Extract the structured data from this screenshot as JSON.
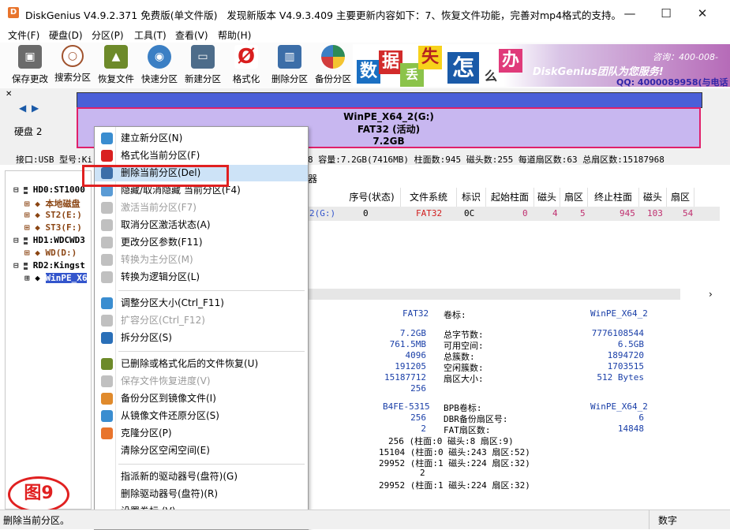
{
  "window": {
    "title": "DiskGenius V4.9.2.371 免费版(单文件版)",
    "notice": "发现新版本 V4.9.3.409 主要更新内容如下：7、恢复文件功能，完善对mp4格式的支持。",
    "minimize": "—",
    "maximize": "☐",
    "close": "✕",
    "icon_letter": "D"
  },
  "menu": [
    "文件(F)",
    "硬盘(D)",
    "分区(P)",
    "工具(T)",
    "查看(V)",
    "帮助(H)"
  ],
  "toolbar": [
    {
      "label": "保存更改",
      "icon": "save-icon",
      "color": "#6b6b6b"
    },
    {
      "label": "搜索分区",
      "icon": "magnifier-icon",
      "color": "#a0522d"
    },
    {
      "label": "恢复文件",
      "icon": "recover-box-icon",
      "color": "#6d8a2a"
    },
    {
      "label": "快速分区",
      "icon": "disk-icon",
      "color": "#3b7fc4"
    },
    {
      "label": "新建分区",
      "icon": "laptop-icon",
      "color": "#4d6c8a"
    },
    {
      "label": "格式化",
      "icon": "no-sign-icon",
      "color": "#d91e1e"
    },
    {
      "label": "删除分区",
      "icon": "trash-icon",
      "color": "#3c6ea8"
    },
    {
      "label": "备份分区",
      "icon": "pie-icon",
      "color": "#2e8b57"
    }
  ],
  "banner": {
    "tiles": [
      "数",
      "据",
      "丢",
      "失",
      "怎",
      "么",
      "办"
    ],
    "brand": "DiskGenius团队为您服务!",
    "phone": "咨询：400-008-",
    "qq": "QQ: 4000089958(与电话"
  },
  "disk_header": {
    "disk_label": "硬盘 2",
    "partition_name": "WinPE_X64_2(G:)",
    "partition_fs": "FAT32 (活动)",
    "partition_size": "7.2GB"
  },
  "infobar": {
    "prefix": "接口:USB  型号:Ki",
    "suffix": "8  容量:7.2GB(7416MB)  柱面数:945  磁头数:255  每道扇区数:63  总扇区数:15187968"
  },
  "tree": [
    {
      "text": "HD0:ST1000",
      "color": "#000"
    },
    {
      "text": "本地磁盘",
      "color": "#8b4513"
    },
    {
      "text": "ST2(E:)",
      "color": "#8b4513"
    },
    {
      "text": "ST3(F:)",
      "color": "#8b4513"
    },
    {
      "text": "HD1:WDCWD3",
      "color": "#000"
    },
    {
      "text": "WD(D:)",
      "color": "#8b4513"
    },
    {
      "text": "RD2:Kingst",
      "color": "#000"
    },
    {
      "text": "WinPE_X6",
      "color": "#fff"
    }
  ],
  "table": {
    "tab_fragment": "器",
    "headers": [
      "序号(状态)",
      "文件系统",
      "标识",
      "起始柱面",
      "磁头",
      "扇区",
      "终止柱面",
      "磁头",
      "扇区"
    ],
    "row": {
      "name_fragment": "2(G:)",
      "index": "0",
      "fs": "FAT32",
      "id": "0C",
      "start_cyl": "0",
      "start_head": "4",
      "start_sector": "5",
      "end_cyl": "945",
      "end_head": "103",
      "end_sector": "54"
    }
  },
  "details": {
    "fs_type": "FAT32",
    "volume_label_key": "卷标:",
    "volume_label_val": "WinPE_X64_2",
    "left_values": [
      "7.2GB",
      "761.5MB",
      "4096",
      "191205",
      "15187712",
      "256"
    ],
    "mid_keys": [
      "总字节数:",
      "可用空间:",
      "总簇数:",
      "空闲簇数:",
      "扇区大小:"
    ],
    "right_values": [
      "7776108544",
      "6.5GB",
      "1894720",
      "1703515",
      "512 Bytes"
    ],
    "serial": "B4FE-5315",
    "bpb_key": "BPB卷标:",
    "bpb_val": "WinPE_X64_2",
    "reserved": "256",
    "dbr_key": "DBR备份扇区号:",
    "dbr_val": "6",
    "fat_count": "2",
    "fat_sectors_key": "FAT扇区数:",
    "fat_sectors_val": "14848",
    "loc1": "256 (柱面:0 磁头:8 扇区:9)",
    "loc2": "15104 (柱面:0 磁头:243 扇区:52)",
    "loc3": "29952 (柱面:1 磁头:224 扇区:32)",
    "loc4a": "2",
    "loc4b": "29952 (柱面:1 磁头:224 扇区:32)"
  },
  "context_menu": [
    {
      "label": "建立新分区(N)",
      "icon": "new-partition-icon",
      "color": "#3a8dd0",
      "disabled": false
    },
    {
      "label": "格式化当前分区(F)",
      "icon": "format-icon",
      "color": "#d92020",
      "disabled": false
    },
    {
      "label": "删除当前分区(Del)",
      "icon": "delete-partition-icon",
      "color": "#3c6ea8",
      "disabled": false,
      "highlight": true
    },
    {
      "label": "隐藏/取消隐藏 当前分区(F4)",
      "icon": "hide-icon",
      "color": "#5a9bd5",
      "disabled": false
    },
    {
      "label": "激活当前分区(F7)",
      "icon": "activate-icon",
      "color": "#c0c0c0",
      "disabled": true
    },
    {
      "label": "取消分区激活状态(A)",
      "icon": "deactivate-icon",
      "color": "#c0c0c0",
      "disabled": false
    },
    {
      "label": "更改分区参数(F11)",
      "icon": "params-icon",
      "color": "#c0c0c0",
      "disabled": false
    },
    {
      "label": "转换为主分区(M)",
      "icon": "to-primary-icon",
      "color": "#c0c0c0",
      "disabled": true
    },
    {
      "label": "转换为逻辑分区(L)",
      "icon": "to-logical-icon",
      "color": "#c0c0c0",
      "disabled": false
    },
    {
      "sep": true
    },
    {
      "label": "调整分区大小(Ctrl_F11)",
      "icon": "resize-icon",
      "color": "#3a8dd0",
      "disabled": false
    },
    {
      "label": "扩容分区(Ctrl_F12)",
      "icon": "extend-icon",
      "color": "#c0c0c0",
      "disabled": true
    },
    {
      "label": "拆分分区(S)",
      "icon": "split-icon",
      "color": "#2a6fb8",
      "disabled": false
    },
    {
      "sep": true
    },
    {
      "label": "已删除或格式化后的文件恢复(U)",
      "icon": "recover-icon",
      "color": "#6d8a2a",
      "disabled": false
    },
    {
      "label": "保存文件恢复进度(V)",
      "icon": "save-progress-icon",
      "color": "#c0c0c0",
      "disabled": true
    },
    {
      "label": "备份分区到镜像文件(I)",
      "icon": "backup-icon",
      "color": "#e08a2c",
      "disabled": false
    },
    {
      "label": "从镜像文件还原分区(S)",
      "icon": "restore-icon",
      "color": "#3a8dd0",
      "disabled": false
    },
    {
      "label": "克隆分区(P)",
      "icon": "clone-icon",
      "color": "#e8742c",
      "disabled": false
    },
    {
      "label": "清除分区空闲空间(E)",
      "icon": "wipe-icon",
      "color": "#ffffff",
      "disabled": false
    },
    {
      "sep": true
    },
    {
      "label": "指派新的驱动器号(盘符)(G)",
      "icon": "assign-letter-icon",
      "color": "#ffffff",
      "disabled": false
    },
    {
      "label": "删除驱动器号(盘符)(R)",
      "icon": "remove-letter-icon",
      "color": "#ffffff",
      "disabled": false
    },
    {
      "label": "设置卷标 (V)",
      "icon": "volume-label-icon",
      "color": "#ffffff",
      "disabled": false
    }
  ],
  "figure_label": "图9",
  "status": {
    "left": "删除当前分区。",
    "right": "数字"
  }
}
